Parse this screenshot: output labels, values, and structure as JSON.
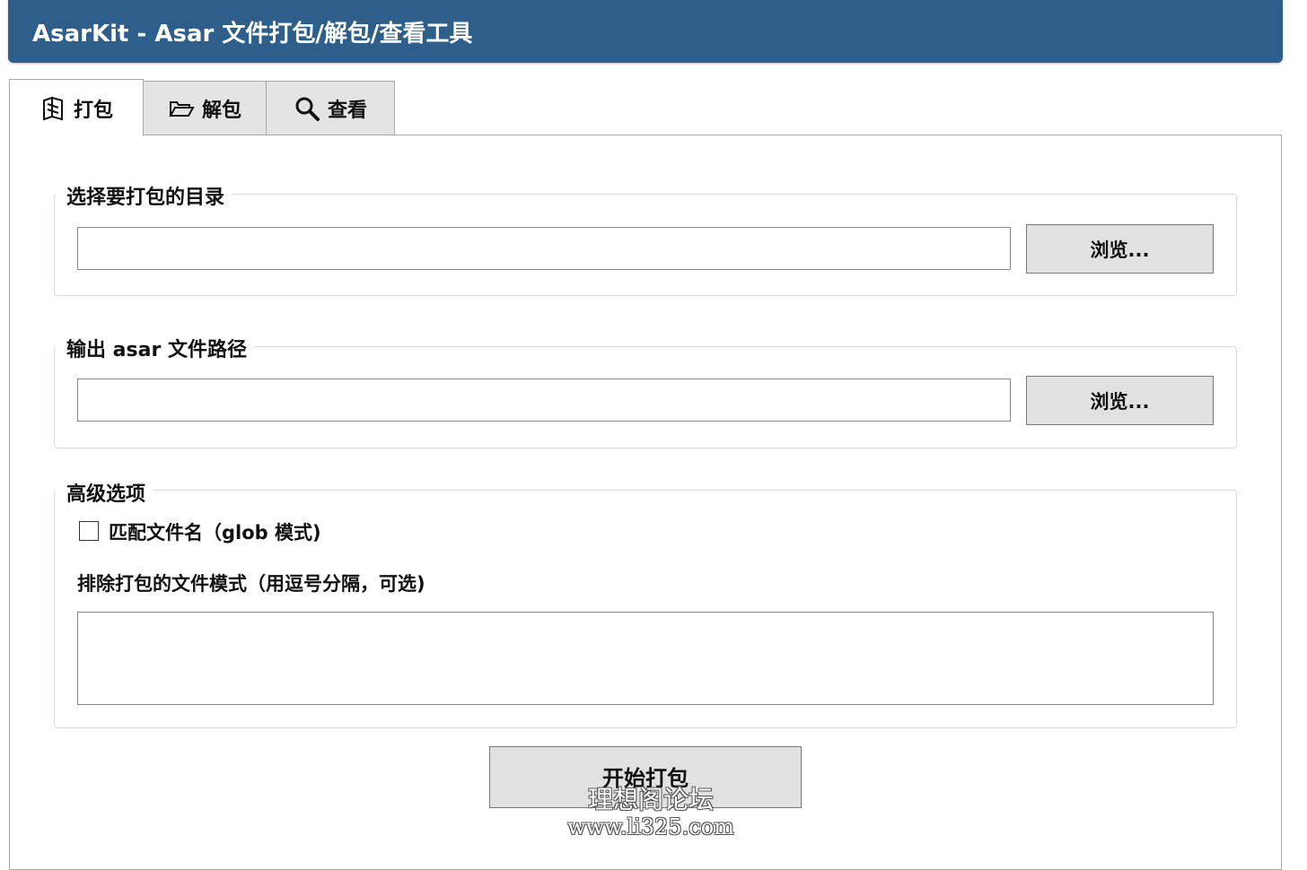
{
  "window": {
    "title": "AsarKit - Asar 文件打包/解包/查看工具"
  },
  "tabs": [
    {
      "label": "打包",
      "icon": "box-icon",
      "active": true
    },
    {
      "label": "解包",
      "icon": "folder-open-icon",
      "active": false
    },
    {
      "label": "查看",
      "icon": "magnifier-icon",
      "active": false
    }
  ],
  "pack": {
    "source_group": {
      "legend": "选择要打包的目录",
      "value": "",
      "browse_label": "浏览..."
    },
    "output_group": {
      "legend": "输出 asar 文件路径",
      "value": "",
      "browse_label": "浏览..."
    },
    "advanced_group": {
      "legend": "高级选项",
      "glob_checkbox_label": "匹配文件名（glob 模式)",
      "glob_checked": false,
      "exclude_label": "排除打包的文件模式（用逗号分隔，可选)",
      "exclude_value": ""
    },
    "start_label": "开始打包"
  },
  "watermark": {
    "line1": "理想阁论坛",
    "line2": "www.li325.com"
  }
}
